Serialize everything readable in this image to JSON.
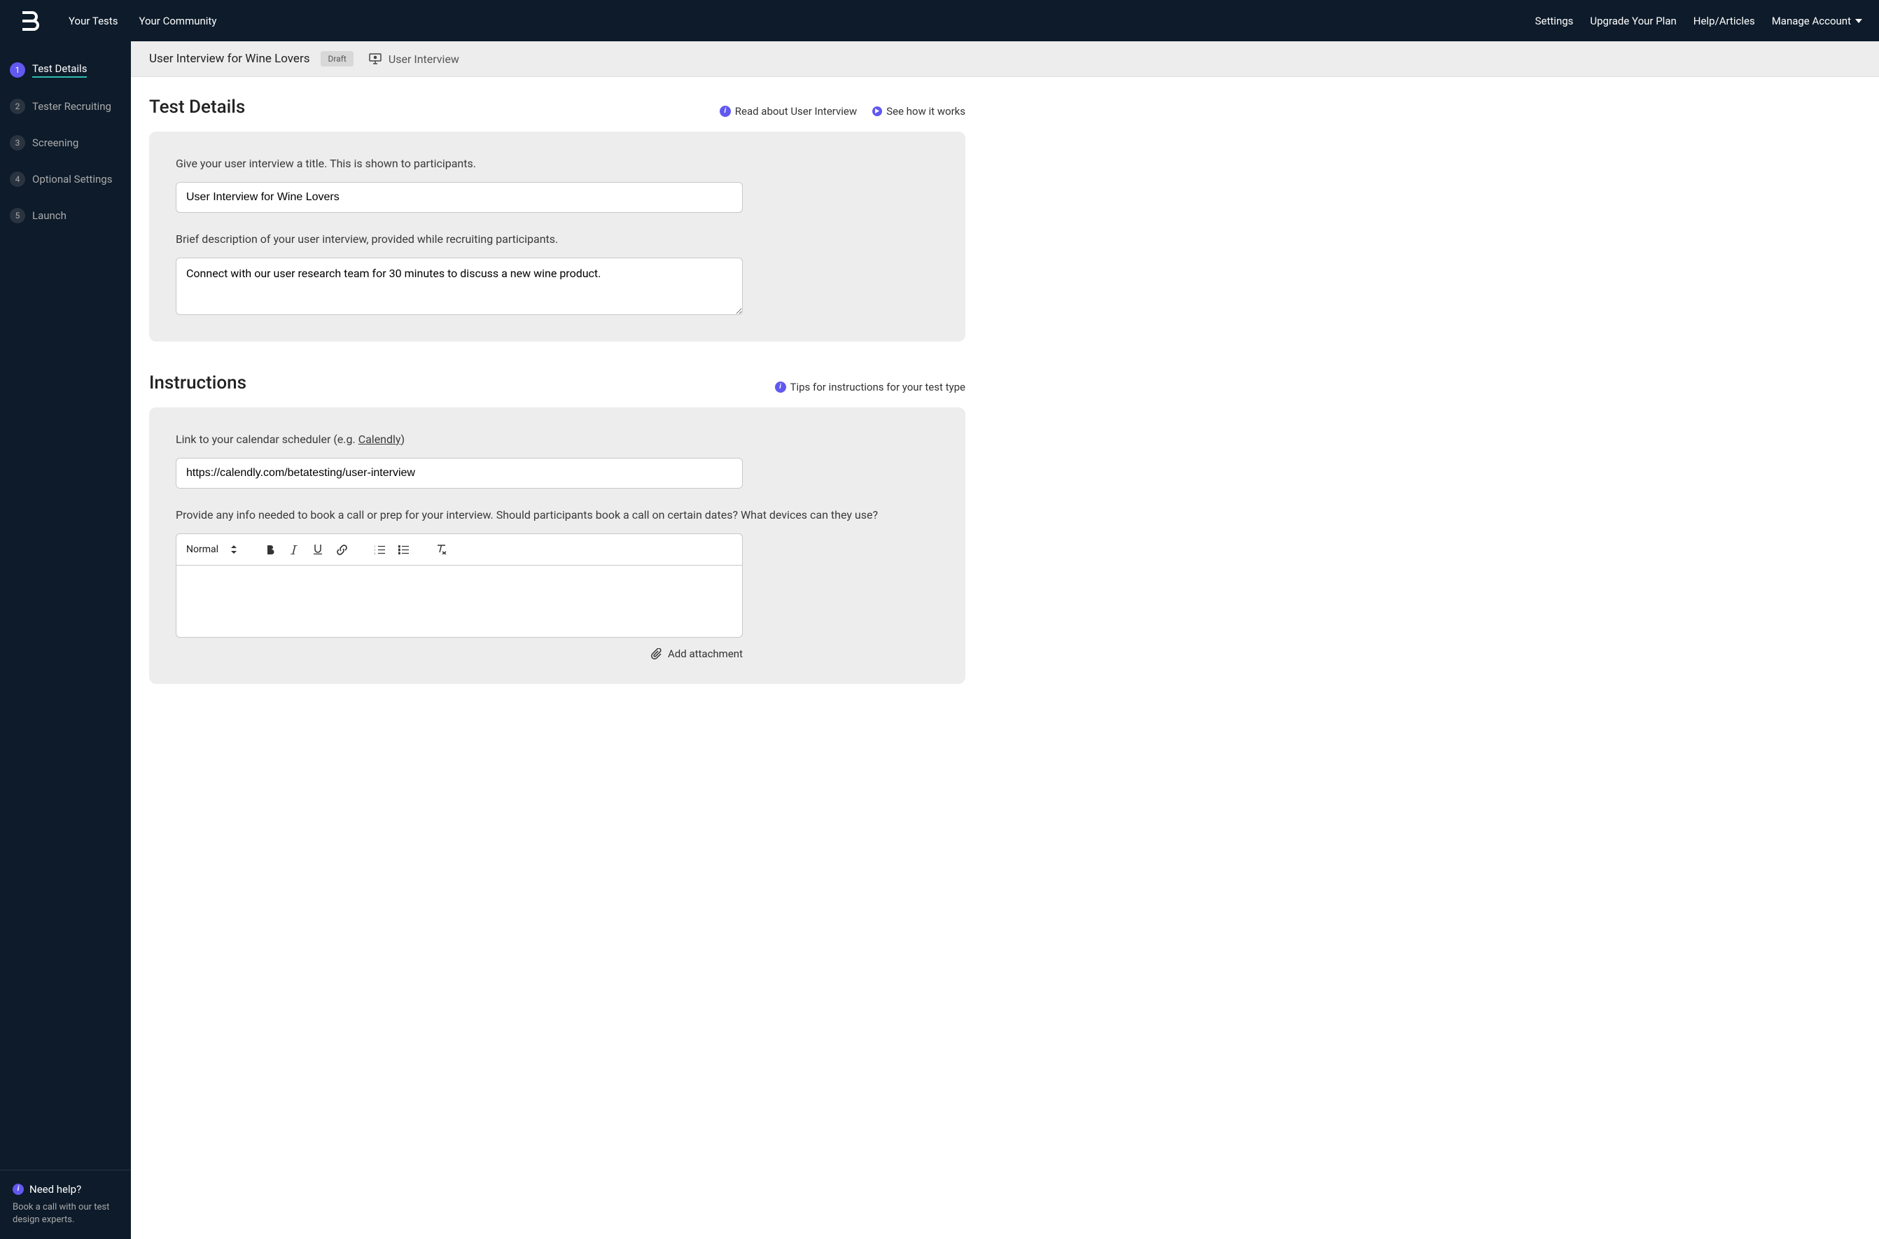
{
  "header": {
    "nav_tests": "Your Tests",
    "nav_community": "Your Community",
    "nav_settings": "Settings",
    "nav_upgrade": "Upgrade Your Plan",
    "nav_help": "Help/Articles",
    "nav_account": "Manage Account"
  },
  "sidebar": {
    "steps": [
      {
        "num": "1",
        "label": "Test Details",
        "active": true
      },
      {
        "num": "2",
        "label": "Tester Recruiting",
        "active": false
      },
      {
        "num": "3",
        "label": "Screening",
        "active": false
      },
      {
        "num": "4",
        "label": "Optional Settings",
        "active": false
      },
      {
        "num": "5",
        "label": "Launch",
        "active": false
      }
    ],
    "help_title": "Need help?",
    "help_text": "Book a call with our test design experts."
  },
  "subheader": {
    "title": "User Interview for Wine Lovers",
    "status": "Draft",
    "test_type": "User Interview"
  },
  "section1": {
    "title": "Test Details",
    "help1": "Read about User Interview",
    "help2": "See how it works",
    "title_label": "Give your user interview a title. This is shown to participants.",
    "title_value": "User Interview for Wine Lovers",
    "desc_label": "Brief description of your user interview, provided while recruiting participants.",
    "desc_value": "Connect with our user research team for 30 minutes to discuss a new wine product."
  },
  "section2": {
    "title": "Instructions",
    "help1": "Tips for instructions for your test type",
    "link_label_pre": "Link to your calendar scheduler (e.g. ",
    "link_label_link": "Calendly",
    "link_label_post": ")",
    "link_value": "https://calendly.com/betatesting/user-interview",
    "info_label": "Provide any info needed to book a call or prep for your interview. Should participants book a call on certain dates? What devices can they use?",
    "editor_format": "Normal",
    "add_attachment": "Add attachment"
  }
}
